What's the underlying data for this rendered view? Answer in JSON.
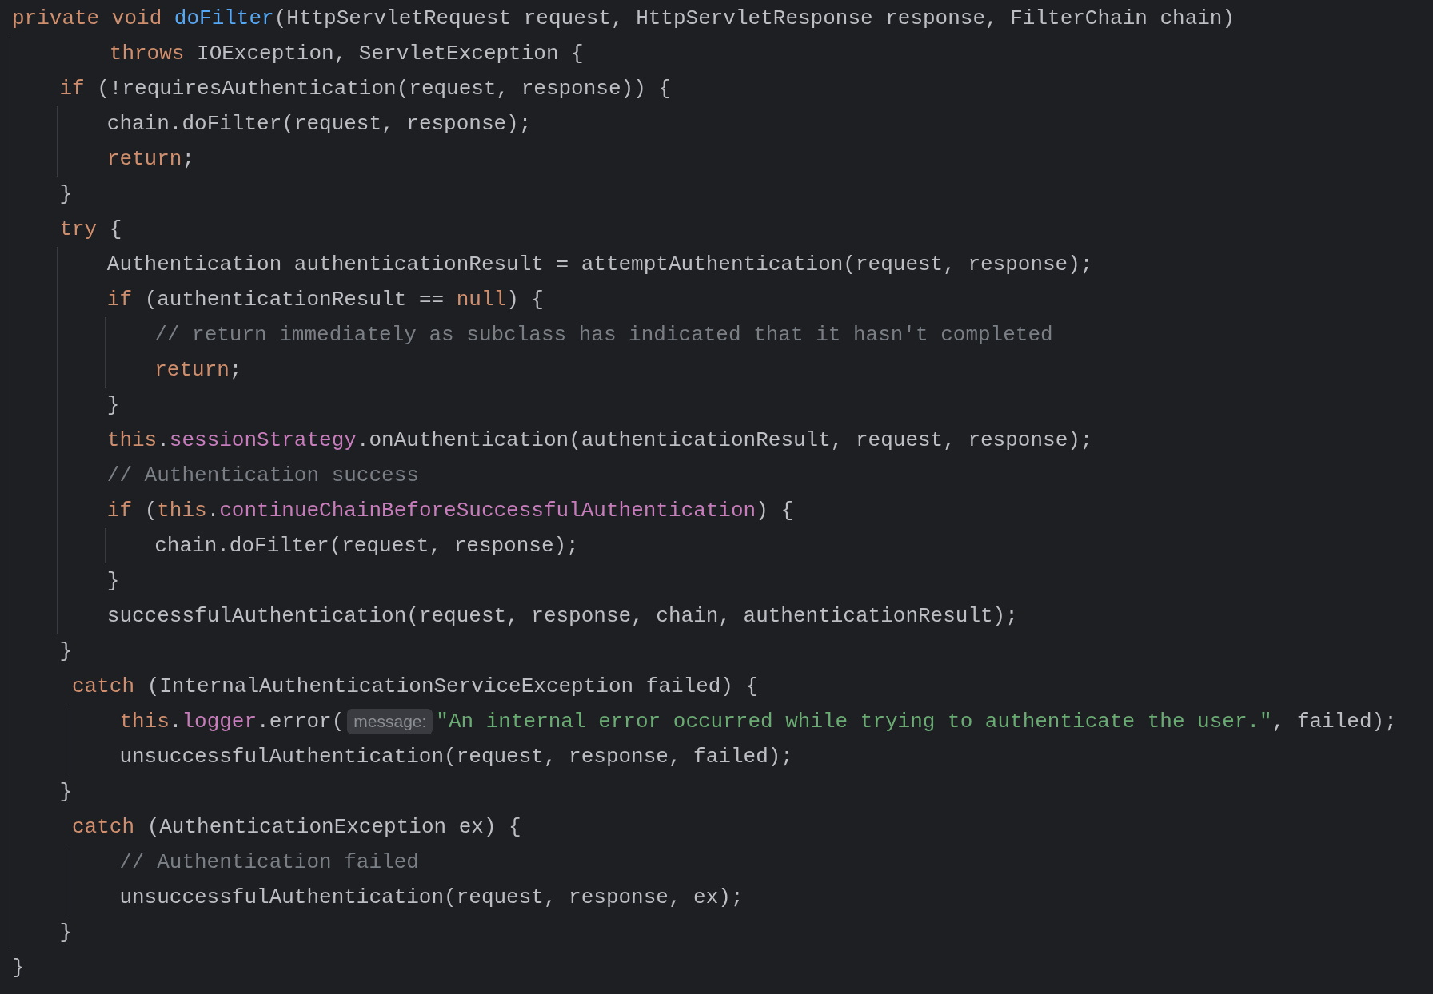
{
  "editor": {
    "lines": [
      {
        "kind": "line",
        "tokens": [
          {
            "kind": "keyword",
            "text": "private void "
          },
          {
            "kind": "function",
            "text": "doFilter"
          },
          {
            "kind": "plain",
            "text": "(HttpServletRequest request, HttpServletResponse response, FilterChain chain)"
          }
        ],
        "children": [
          {
            "kind": "continuation",
            "tokens": [
              {
                "kind": "keyword",
                "text": "throws "
              },
              {
                "kind": "plain",
                "text": "IOException, ServletException {"
              }
            ]
          },
          {
            "kind": "line",
            "tokens": [
              {
                "kind": "keyword",
                "text": "if "
              },
              {
                "kind": "plain",
                "text": "(!requiresAuthentication(request, response)) {"
              }
            ],
            "children": [
              {
                "kind": "line",
                "tokens": [
                  {
                    "kind": "plain",
                    "text": "chain.doFilter(request, response);"
                  }
                ]
              },
              {
                "kind": "line",
                "tokens": [
                  {
                    "kind": "keyword",
                    "text": "return"
                  },
                  {
                    "kind": "plain",
                    "text": ";"
                  }
                ]
              }
            ]
          },
          {
            "kind": "line",
            "tokens": [
              {
                "kind": "plain",
                "text": "}"
              }
            ]
          },
          {
            "kind": "line",
            "tokens": [
              {
                "kind": "keyword",
                "text": "try "
              },
              {
                "kind": "plain",
                "text": "{"
              }
            ],
            "children": [
              {
                "kind": "line",
                "tokens": [
                  {
                    "kind": "plain",
                    "text": "Authentication authenticationResult = attemptAuthentication(request, response);"
                  }
                ]
              },
              {
                "kind": "line",
                "tokens": [
                  {
                    "kind": "keyword",
                    "text": "if "
                  },
                  {
                    "kind": "plain",
                    "text": "(authenticationResult == "
                  },
                  {
                    "kind": "keyword",
                    "text": "null"
                  },
                  {
                    "kind": "plain",
                    "text": ") {"
                  }
                ],
                "children": [
                  {
                    "kind": "line",
                    "tokens": [
                      {
                        "kind": "comment",
                        "text": "// return immediately as subclass has indicated that it hasn't completed"
                      }
                    ]
                  },
                  {
                    "kind": "line",
                    "tokens": [
                      {
                        "kind": "keyword",
                        "text": "return"
                      },
                      {
                        "kind": "plain",
                        "text": ";"
                      }
                    ]
                  }
                ]
              },
              {
                "kind": "line",
                "tokens": [
                  {
                    "kind": "plain",
                    "text": "}"
                  }
                ]
              },
              {
                "kind": "line",
                "tokens": [
                  {
                    "kind": "keyword",
                    "text": "this"
                  },
                  {
                    "kind": "plain",
                    "text": "."
                  },
                  {
                    "kind": "field",
                    "text": "sessionStrategy"
                  },
                  {
                    "kind": "plain",
                    "text": ".onAuthentication(authenticationResult, request, response);"
                  }
                ]
              },
              {
                "kind": "line",
                "tokens": [
                  {
                    "kind": "comment",
                    "text": "// Authentication success"
                  }
                ]
              },
              {
                "kind": "line",
                "tokens": [
                  {
                    "kind": "keyword",
                    "text": "if "
                  },
                  {
                    "kind": "plain",
                    "text": "("
                  },
                  {
                    "kind": "keyword",
                    "text": "this"
                  },
                  {
                    "kind": "plain",
                    "text": "."
                  },
                  {
                    "kind": "field",
                    "text": "continueChainBeforeSuccessfulAuthentication"
                  },
                  {
                    "kind": "plain",
                    "text": ") {"
                  }
                ],
                "children": [
                  {
                    "kind": "line",
                    "tokens": [
                      {
                        "kind": "plain",
                        "text": "chain.doFilter(request, response);"
                      }
                    ]
                  }
                ]
              },
              {
                "kind": "line",
                "tokens": [
                  {
                    "kind": "plain",
                    "text": "}"
                  }
                ]
              },
              {
                "kind": "line",
                "tokens": [
                  {
                    "kind": "plain",
                    "text": "successfulAuthentication(request, response, chain, authenticationResult);"
                  }
                ]
              }
            ]
          },
          {
            "kind": "line",
            "tokens": [
              {
                "kind": "plain",
                "text": "}"
              }
            ]
          },
          {
            "kind": "offset",
            "tokens": [
              {
                "kind": "keyword",
                "text": "catch "
              },
              {
                "kind": "plain",
                "text": "(InternalAuthenticationServiceException failed) {"
              }
            ],
            "children": [
              {
                "kind": "line",
                "tokens": [
                  {
                    "kind": "keyword",
                    "text": "this"
                  },
                  {
                    "kind": "plain",
                    "text": "."
                  },
                  {
                    "kind": "field",
                    "text": "logger"
                  },
                  {
                    "kind": "plain",
                    "text": ".error("
                  },
                  {
                    "kind": "hint",
                    "text": "message:"
                  },
                  {
                    "kind": "string",
                    "text": "\"An internal error occurred while trying to authenticate the user.\""
                  },
                  {
                    "kind": "plain",
                    "text": ", failed);"
                  }
                ]
              },
              {
                "kind": "line",
                "tokens": [
                  {
                    "kind": "plain",
                    "text": "unsuccessfulAuthentication(request, response, failed);"
                  }
                ]
              }
            ]
          },
          {
            "kind": "line",
            "tokens": [
              {
                "kind": "plain",
                "text": "}"
              }
            ]
          },
          {
            "kind": "offset",
            "tokens": [
              {
                "kind": "keyword",
                "text": "catch "
              },
              {
                "kind": "plain",
                "text": "(AuthenticationException ex) {"
              }
            ],
            "children": [
              {
                "kind": "line",
                "tokens": [
                  {
                    "kind": "comment",
                    "text": "// Authentication failed"
                  }
                ]
              },
              {
                "kind": "line",
                "tokens": [
                  {
                    "kind": "plain",
                    "text": "unsuccessfulAuthentication(request, response, ex);"
                  }
                ]
              }
            ]
          },
          {
            "kind": "line",
            "tokens": [
              {
                "kind": "plain",
                "text": "}"
              }
            ]
          }
        ]
      },
      {
        "kind": "line",
        "tokens": [
          {
            "kind": "plain",
            "text": "}"
          }
        ]
      }
    ]
  }
}
